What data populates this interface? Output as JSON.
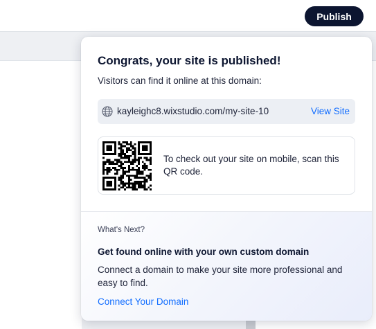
{
  "header": {
    "publish_label": "Publish"
  },
  "popover": {
    "title": "Congrats, your site is published!",
    "subtitle": "Visitors can find it online at this domain:",
    "domain": {
      "icon": "globe-icon",
      "url": "kayleighc8.wixstudio.com/my-site-10",
      "view_label": "View Site"
    },
    "qr": {
      "text": "To check out your site on mobile, scan this QR code."
    },
    "next": {
      "label": "What's Next?",
      "title": "Get found online with your own custom domain",
      "body": "Connect a domain to make your site more professional and easy to find.",
      "link": "Connect Your Domain"
    }
  },
  "colors": {
    "brand_dark": "#0c1530",
    "link": "#116dff",
    "domain_bg": "#eceff4"
  }
}
